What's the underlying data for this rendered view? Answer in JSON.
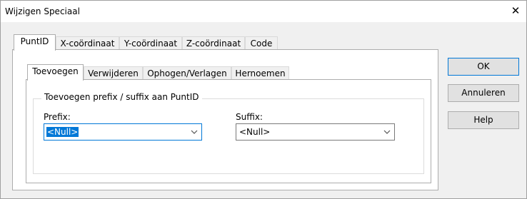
{
  "window": {
    "title": "Wijzigen Speciaal",
    "close_icon": "close-icon"
  },
  "tabs": [
    "PuntID",
    "X-coördinaat",
    "Y-coördinaat",
    "Z-coördinaat",
    "Code"
  ],
  "selected_tab": "PuntID",
  "subtabs": [
    "Toevoegen",
    "Verwijderen",
    "Ophogen/Verlagen",
    "Hernoemen"
  ],
  "selected_subtab": "Toevoegen",
  "group": {
    "title": "Toevoegen prefix / suffix aan PuntID",
    "prefix_label": "Prefix:",
    "prefix_value": "<Null>",
    "suffix_label": "Suffix:",
    "suffix_value": "<Null>"
  },
  "buttons": {
    "ok": "OK",
    "cancel": "Annuleren",
    "help": "Help"
  },
  "colors": {
    "focus_blue": "#0078d7",
    "dialog_bg": "#f0f0f0"
  }
}
